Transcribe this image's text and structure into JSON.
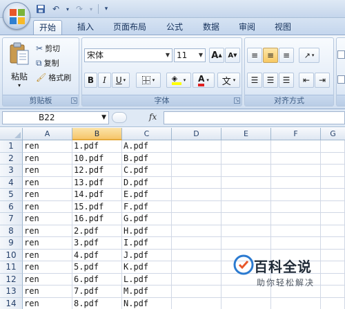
{
  "ribbon_tabs": [
    "开始",
    "插入",
    "页面布局",
    "公式",
    "数据",
    "审阅",
    "视图"
  ],
  "clipboard": {
    "paste_label": "粘贴",
    "cut_label": "剪切",
    "copy_label": "复制",
    "format_painter_label": "格式刷",
    "group_label": "剪贴板"
  },
  "font": {
    "font_name": "宋体",
    "font_size": "11",
    "bold": "B",
    "italic": "I",
    "underline": "U",
    "font_color_glyph": "A",
    "phonetic_glyph": "文",
    "grow_glyph": "A",
    "shrink_glyph": "A",
    "group_label": "字体"
  },
  "alignment": {
    "group_label": "对齐方式"
  },
  "formula_bar": {
    "name_box": "B22",
    "fx_label": "fx",
    "formula_value": ""
  },
  "sheet": {
    "columns": [
      "A",
      "B",
      "C",
      "D",
      "E",
      "F",
      "G"
    ],
    "selected_column": "B",
    "rows": [
      {
        "num": "1",
        "a": "ren",
        "b": "1.pdf",
        "c": "A.pdf"
      },
      {
        "num": "2",
        "a": "ren",
        "b": "10.pdf",
        "c": "B.pdf"
      },
      {
        "num": "3",
        "a": "ren",
        "b": "12.pdf",
        "c": "C.pdf"
      },
      {
        "num": "4",
        "a": "ren",
        "b": "13.pdf",
        "c": "D.pdf"
      },
      {
        "num": "5",
        "a": "ren",
        "b": "14.pdf",
        "c": "E.pdf"
      },
      {
        "num": "6",
        "a": "ren",
        "b": "15.pdf",
        "c": "F.pdf"
      },
      {
        "num": "7",
        "a": "ren",
        "b": "16.pdf",
        "c": "G.pdf"
      },
      {
        "num": "8",
        "a": "ren",
        "b": "2.pdf",
        "c": "H.pdf"
      },
      {
        "num": "9",
        "a": "ren",
        "b": "3.pdf",
        "c": "I.pdf"
      },
      {
        "num": "10",
        "a": "ren",
        "b": "4.pdf",
        "c": "J.pdf"
      },
      {
        "num": "11",
        "a": "ren",
        "b": "5.pdf",
        "c": "K.pdf"
      },
      {
        "num": "12",
        "a": "ren",
        "b": "6.pdf",
        "c": "L.pdf"
      },
      {
        "num": "13",
        "a": "ren",
        "b": "7.pdf",
        "c": "M.pdf"
      },
      {
        "num": "14",
        "a": "ren",
        "b": "8.pdf",
        "c": "N.pdf"
      }
    ]
  },
  "watermark": {
    "title": "百科全说",
    "subtitle": "助你轻松解决"
  },
  "colors": {
    "selected_header": "#f6c66b",
    "ribbon_blue": "#dfe9f5",
    "grid_line": "#d0d7e5"
  }
}
